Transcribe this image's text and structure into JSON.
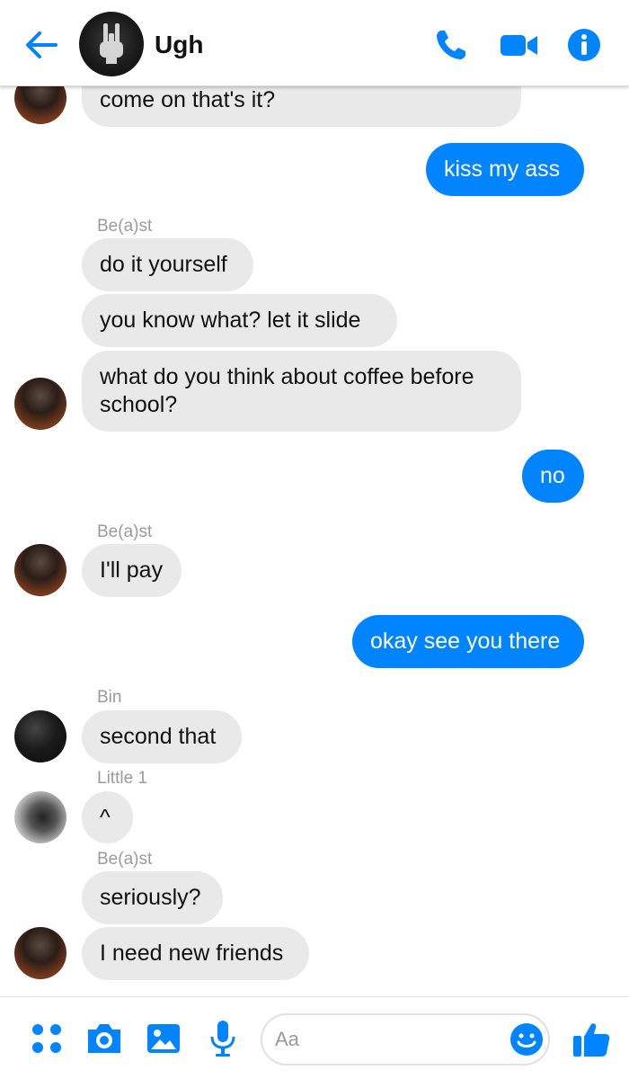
{
  "header": {
    "title": "Ugh",
    "back_icon": "back-arrow-icon",
    "actions": [
      "phone-icon",
      "video-camera-icon",
      "info-icon"
    ]
  },
  "colors": {
    "accent": "#0084ff",
    "incoming_bubble": "#e9e9e9",
    "sender_name": "#9a9a9a"
  },
  "messages": [
    {
      "id": "m1",
      "direction": "in",
      "text": "come on that's it?"
    },
    {
      "id": "m2",
      "direction": "out",
      "text": "kiss my ass"
    },
    {
      "id": "m3",
      "direction": "in",
      "sender": "Be(a)st",
      "text": "do it yourself"
    },
    {
      "id": "m4",
      "direction": "in",
      "text": "you know what? let it slide"
    },
    {
      "id": "m5",
      "direction": "in",
      "text": "what do you think about coffee before school?"
    },
    {
      "id": "m6",
      "direction": "out",
      "text": "no"
    },
    {
      "id": "m7",
      "direction": "in",
      "sender": "Be(a)st",
      "text": "I'll pay"
    },
    {
      "id": "m8",
      "direction": "out",
      "text": "okay see you there"
    },
    {
      "id": "m9",
      "direction": "in",
      "sender": "Bin",
      "text": "second that"
    },
    {
      "id": "m10",
      "direction": "in",
      "sender": "Little 1",
      "text": "^"
    },
    {
      "id": "m11",
      "direction": "in",
      "sender": "Be(a)st",
      "text": "seriously?"
    },
    {
      "id": "m12",
      "direction": "in",
      "text": "I need new friends"
    }
  ],
  "composer": {
    "placeholder": "Aa",
    "icons": [
      "grid-icon",
      "camera-icon",
      "image-icon",
      "microphone-icon",
      "emoji-icon",
      "thumbs-up-icon"
    ]
  }
}
